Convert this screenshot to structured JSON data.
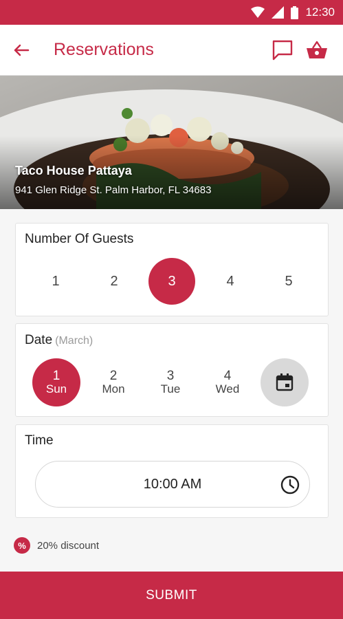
{
  "status_bar": {
    "time": "12:30"
  },
  "app_bar": {
    "title": "Reservations"
  },
  "hero": {
    "restaurant_name": "Taco House Pattaya",
    "address": "941 Glen Ridge St. Palm Harbor, FL 34683"
  },
  "guests": {
    "title": "Number Of Guests",
    "options": [
      "1",
      "2",
      "3",
      "4",
      "5"
    ],
    "selected": "3"
  },
  "date": {
    "title": "Date",
    "month": "(March)",
    "options": [
      {
        "num": "1",
        "day": "Sun"
      },
      {
        "num": "2",
        "day": "Mon"
      },
      {
        "num": "3",
        "day": "Tue"
      },
      {
        "num": "4",
        "day": "Wed"
      }
    ],
    "selected": "1"
  },
  "time": {
    "title": "Time",
    "value": "10:00 AM"
  },
  "discount": {
    "badge": "%",
    "text": "20% discount"
  },
  "submit_label": "SUBMIT",
  "colors": {
    "accent": "#c62a47",
    "selected_date_bg": "#c62a47",
    "calendar_button_bg": "#d9d9d9"
  },
  "icons": {
    "back": "arrow-left-icon",
    "chat": "chat-icon",
    "basket": "basket-icon",
    "calendar": "calendar-icon",
    "clock": "clock-icon"
  }
}
